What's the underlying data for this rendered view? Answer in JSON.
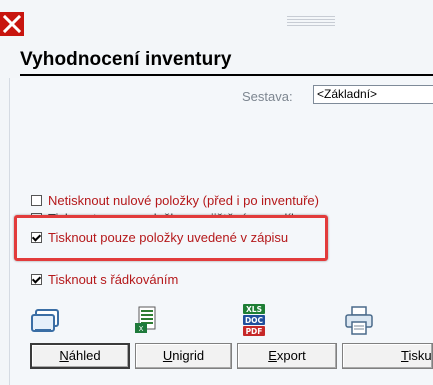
{
  "window": {
    "close_icon": "close-x-icon"
  },
  "header": {
    "title": "Vyhodnocení inventury"
  },
  "sestava": {
    "label": "Sestava:",
    "value": "<Základní>"
  },
  "options": [
    {
      "label": "Netisknout nulové položky (před i po inventuře)",
      "checked": false
    },
    {
      "label": "Tisknout pouze položky se zjištěným rozdílem",
      "checked": false
    },
    {
      "label": "Tisknout pouze položky uvedené v zápisu",
      "checked": true
    },
    {
      "label": "Tisknout s řádkováním",
      "checked": true
    }
  ],
  "icons": {
    "preview": "preview-window-icon",
    "unigrid": "excel-sheet-icon",
    "export": "xls-doc-pdf-icon",
    "print": "printer-icon",
    "export_badges": [
      "XLS",
      "DOC",
      "PDF"
    ]
  },
  "buttons": [
    {
      "first": "N",
      "rest": "áhled"
    },
    {
      "first": "U",
      "rest": "nigrid"
    },
    {
      "first": "E",
      "rest": "xport"
    },
    {
      "first": "T",
      "rest": "isku"
    }
  ],
  "colors": {
    "accent_red": "#e23b3b",
    "close_red": "#c8150f"
  }
}
